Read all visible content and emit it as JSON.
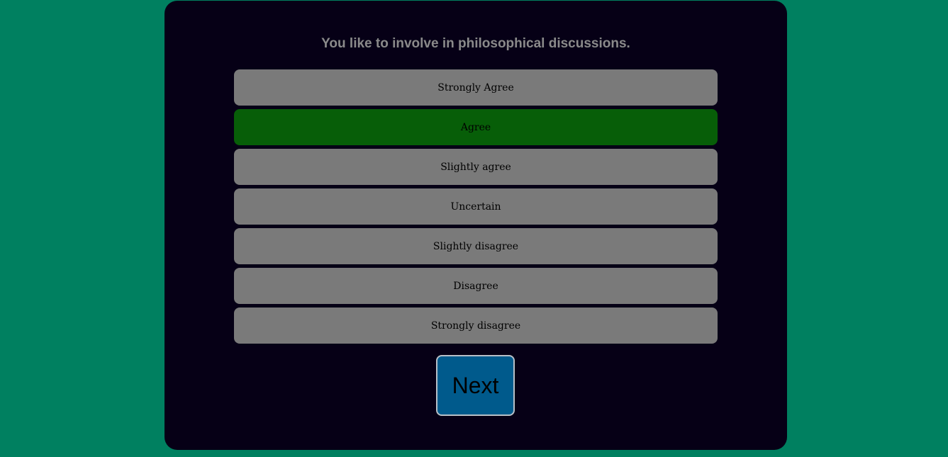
{
  "question": "You like to involve in philosophical discussions.",
  "options": [
    {
      "label": "Strongly Agree",
      "selected": false
    },
    {
      "label": "Agree",
      "selected": true
    },
    {
      "label": "Slightly agree",
      "selected": false
    },
    {
      "label": "Uncertain",
      "selected": false
    },
    {
      "label": "Slightly disagree",
      "selected": false
    },
    {
      "label": "Disagree",
      "selected": false
    },
    {
      "label": "Strongly disagree",
      "selected": false
    }
  ],
  "next_label": "Next",
  "colors": {
    "page_background": "#008060",
    "card_background": "#060016",
    "option_background": "#7a7a7a",
    "option_selected": "#075e08",
    "next_button": "#005a8c"
  }
}
